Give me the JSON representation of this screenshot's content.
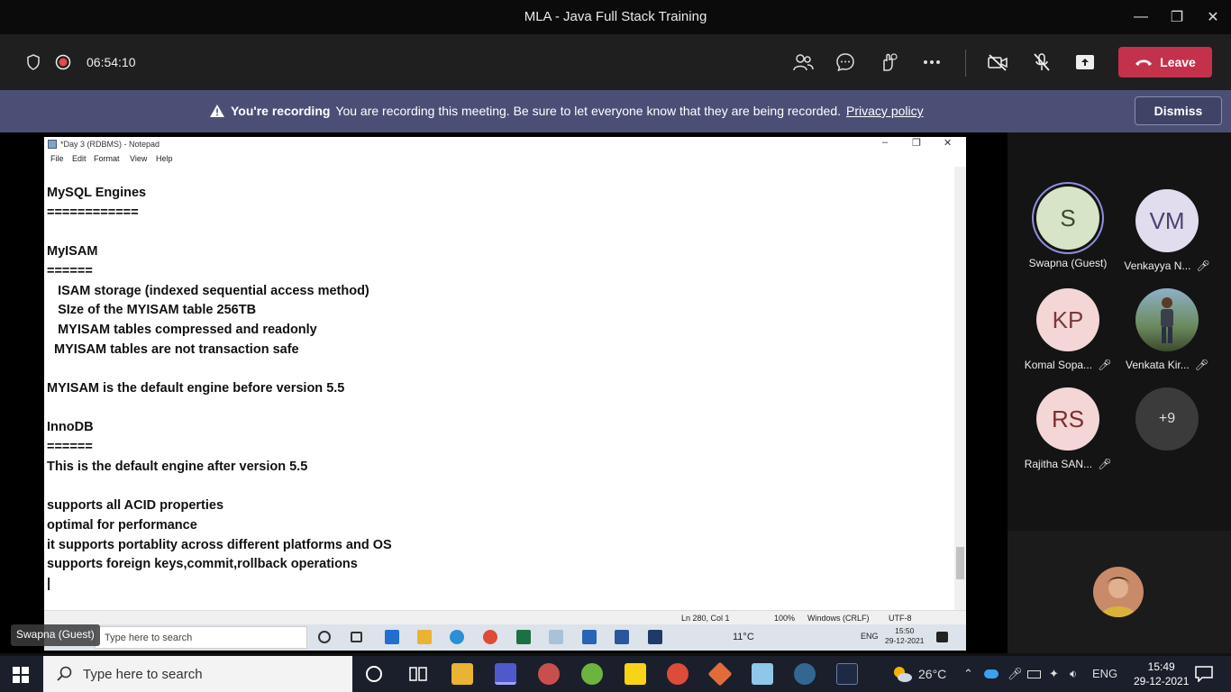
{
  "titlebar": {
    "title": "MLA - Java Full Stack Training"
  },
  "controls": {
    "timer": "06:54:10",
    "leave_label": "Leave"
  },
  "banner": {
    "bold": "You're recording",
    "message": "You are recording this meeting. Be sure to let everyone know that they are being recorded.",
    "link": "Privacy policy",
    "dismiss_label": "Dismiss"
  },
  "notepad": {
    "title": "*Day 3 (RDBMS) - Notepad",
    "menu": [
      "File",
      "Edit",
      "Format",
      "View",
      "Help"
    ],
    "text": "MySQL Engines\n============\n\nMyISAM\n======\n   ISAM storage (indexed sequential access method)\n   SIze of the MYISAM table 256TB\n   MYISAM tables compressed and readonly\n  MYISAM tables are not transaction safe\n\nMYISAM is the default engine before version 5.5\n\nInnoDB\n======\nThis is the default engine after version 5.5\n\nsupports all ACID properties\noptimal for performance\nit supports portablity across different platforms and OS\nsupports foreign keys,commit,rollback operations\n|",
    "status": {
      "position": "Ln 280, Col 1",
      "zoom": "100%",
      "eol": "Windows (CRLF)",
      "encoding": "UTF-8"
    }
  },
  "inner_taskbar": {
    "search_placeholder": "Type here to search",
    "temp": "11°C",
    "lang": "ENG",
    "time": "15:50",
    "date": "29-12-2021"
  },
  "presenter_tag": "Swapna (Guest)",
  "participants": [
    {
      "initials": "S",
      "name": "Swapna (Guest)",
      "muted": false,
      "bg": "#d8e4c8",
      "fg": "#3d4a2a",
      "ring": true
    },
    {
      "initials": "VM",
      "name": "Venkayya N...",
      "muted": true,
      "bg": "#e2dcef",
      "fg": "#4e4470"
    },
    {
      "initials": "KP",
      "name": "Komal Sopa...",
      "muted": true,
      "bg": "#f4d6d6",
      "fg": "#7a3a3a"
    },
    {
      "initials": "",
      "name": "Venkata Kir...",
      "muted": true,
      "bg": "#6b8a5e",
      "fg": "#fff",
      "photo": true
    },
    {
      "initials": "RS",
      "name": "Rajitha SAN...",
      "muted": true,
      "bg": "#f4d6d6",
      "fg": "#7a2f2f"
    },
    {
      "initials": "+9",
      "name": "",
      "muted": false,
      "bg": "#3b3b3b",
      "fg": "#ddd"
    }
  ],
  "taskbar": {
    "search_placeholder": "Type here to search",
    "temp": "26°C",
    "lang": "ENG",
    "time": "15:49",
    "date": "29-12-2021"
  },
  "colors": {
    "leave": "#c4314b",
    "banner": "#4b4f76",
    "teams_bg": "#1f1f1f"
  }
}
